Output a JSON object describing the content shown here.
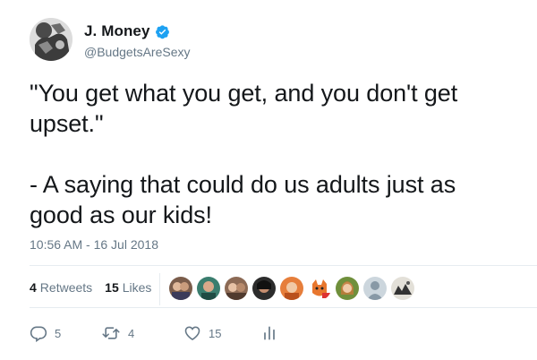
{
  "user": {
    "display_name": "J. Money",
    "handle": "@BudgetsAreSexy",
    "verified_icon": "verified-badge-icon"
  },
  "tweet": {
    "line1": "\"You get what you get, and you don't get upset.\"",
    "line2": "- A saying that could do us adults just as good as our kids!",
    "timestamp": "10:56 AM - 16 Jul 2018"
  },
  "stats": {
    "retweets_count": "4",
    "retweets_label": "Retweets",
    "likes_count": "15",
    "likes_label": "Likes",
    "liker_avatars": [
      "avatar-1",
      "avatar-2",
      "avatar-3",
      "avatar-4",
      "avatar-5",
      "avatar-6",
      "avatar-7",
      "avatar-8",
      "avatar-9"
    ]
  },
  "actions": {
    "reply_count": "5",
    "retweet_count": "4",
    "like_count": "15",
    "icons": [
      "reply-icon",
      "retweet-icon",
      "like-icon",
      "analytics-icon"
    ]
  },
  "colors": {
    "verified": "#1da1f2",
    "secondary_text": "#657786",
    "primary_text": "#14171a",
    "divider": "#e6ecf0"
  }
}
